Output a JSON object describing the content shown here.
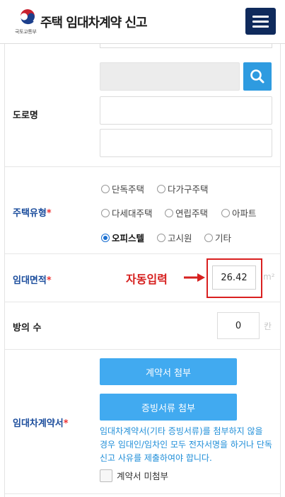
{
  "header": {
    "title": "주택 임대차계약 신고",
    "ministry": "국토교통부",
    "menu_icon": "hamburger-menu-icon",
    "menu_color": "#0f2a5c"
  },
  "address": {
    "label": "도로명",
    "search_icon": "search-icon",
    "search_color": "#2e9be0"
  },
  "housing_type": {
    "label": "주택유형",
    "required_mark": "*",
    "options": [
      "단독주택",
      "다가구주택",
      "다세대주택",
      "연립주택",
      "아파트",
      "오피스텔",
      "고시원",
      "기타"
    ],
    "selected": "오피스텔"
  },
  "area": {
    "label": "임대면적",
    "required_mark": "*",
    "auto_label": "자동입력",
    "value": "26.42",
    "unit": "m²",
    "highlight_color": "#d92020"
  },
  "rooms": {
    "label": "방의 수",
    "value": "0",
    "unit": "칸"
  },
  "contract": {
    "label": "임대차계약서",
    "required_mark": "*",
    "attach_button": "계약서 첨부",
    "evidence_button": "증빙서류 첨부",
    "notice": "임대차계약서(기타 증빙서류)를 첨부하지 않을 경우 임대인/임차인 모두 전자서명을 하거나 단독신고 사유를 제출하여야 합니다.",
    "not_attached_label": "계약서 미첨부",
    "button_color": "#41aaf0"
  }
}
